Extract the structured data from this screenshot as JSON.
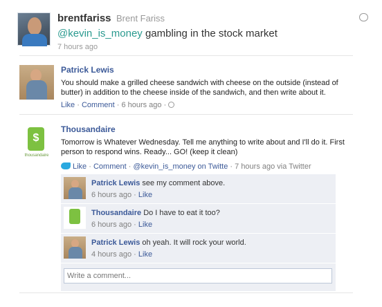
{
  "tweet": {
    "screen_name": "brentfariss",
    "full_name": "Brent Fariss",
    "mention": "@kevin_is_money",
    "text": " gambling in the stock market",
    "time": "7 hours ago"
  },
  "post1": {
    "author": "Patrick Lewis",
    "text": "You should make a grilled cheese sandwich with cheese on the outside (instead of butter) in addition to the cheese inside of the sandwich, and then write about it.",
    "like": "Like",
    "comment": "Comment",
    "time": "6 hours ago"
  },
  "post2": {
    "author": "Thousandaire",
    "avatar_caption": "thousandaire",
    "text": "Tomorrow is Whatever Wednesday. Tell me anything to write about and I'll do it. First person to respond wins. Ready... GO! (keep it clean)",
    "like": "Like",
    "comment": "Comment",
    "via_link": "@kevin_is_money on Twitte",
    "time": "7 hours ago via Twitter"
  },
  "comments": [
    {
      "author": "Patrick Lewis",
      "text": "see my comment above.",
      "time": "6 hours ago",
      "like": "Like"
    },
    {
      "author": "Thousandaire",
      "text": "Do I have to eat it too?",
      "time": "6 hours ago",
      "like": "Like"
    },
    {
      "author": "Patrick Lewis",
      "text": "oh yeah. It will rock your world.",
      "time": "4 hours ago",
      "like": "Like"
    }
  ],
  "comment_box": {
    "placeholder": "Write a comment..."
  }
}
